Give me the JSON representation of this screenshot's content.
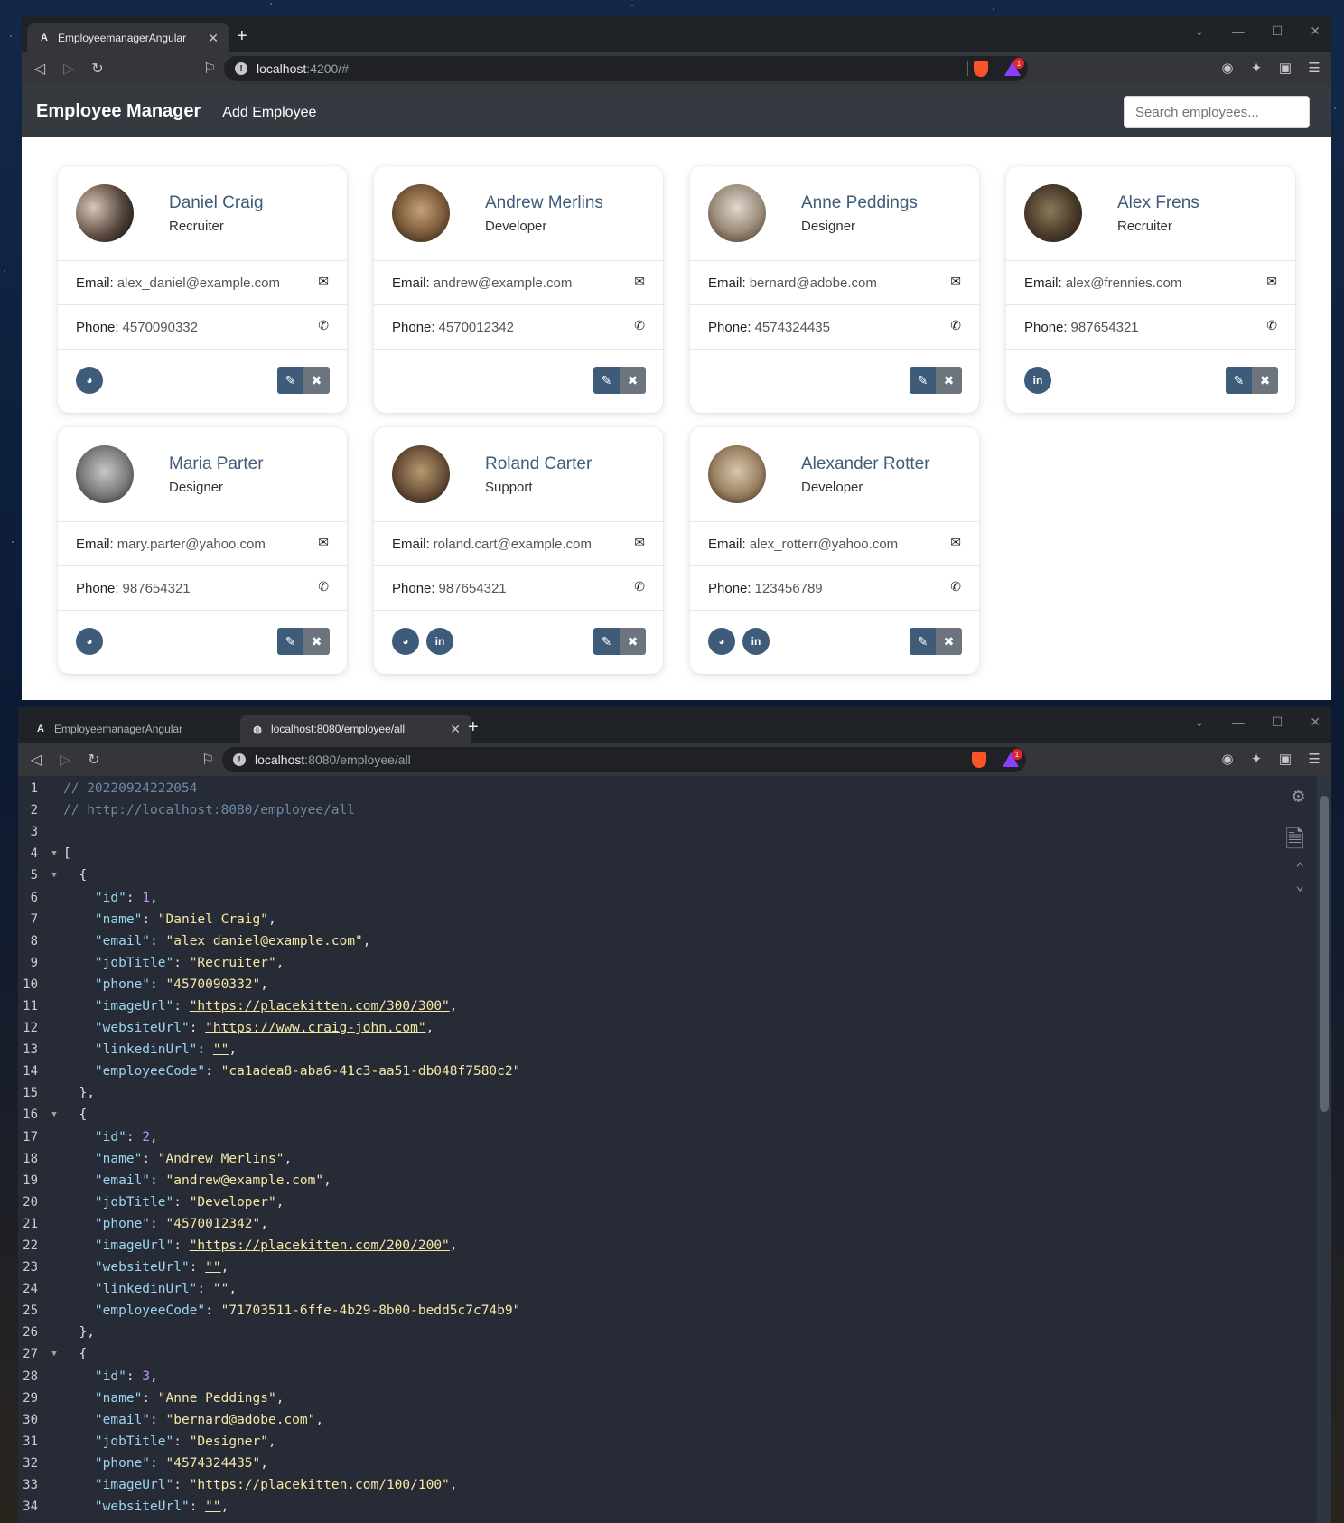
{
  "browser1": {
    "tabs": [
      {
        "title": "EmployeemanagerAngular"
      }
    ],
    "address_host": "localhost",
    "address_path": ":4200/#"
  },
  "app": {
    "brand": "Employee Manager",
    "add_link": "Add Employee",
    "search_placeholder": "Search employees..."
  },
  "labels": {
    "email": "Email:",
    "phone": "Phone:"
  },
  "employees": [
    {
      "name": "Daniel Craig",
      "job": "Recruiter",
      "email": "alex_daniel@example.com",
      "phone": "4570090332"
    },
    {
      "name": "Andrew Merlins",
      "job": "Developer",
      "email": "andrew@example.com",
      "phone": "4570012342"
    },
    {
      "name": "Anne Peddings",
      "job": "Designer",
      "email": "bernard@adobe.com",
      "phone": "4574324435"
    },
    {
      "name": "Alex Frens",
      "job": "Recruiter",
      "email": "alex@frennies.com",
      "phone": "987654321"
    },
    {
      "name": "Maria Parter",
      "job": "Designer",
      "email": "mary.parter@yahoo.com",
      "phone": "987654321"
    },
    {
      "name": "Roland Carter",
      "job": "Support",
      "email": "roland.cart@example.com",
      "phone": "987654321"
    },
    {
      "name": "Alexander Rotter",
      "job": "Developer",
      "email": "alex_rotterr@yahoo.com",
      "phone": "123456789"
    }
  ],
  "browser2": {
    "tabs": [
      {
        "title": "EmployeemanagerAngular"
      },
      {
        "title": "localhost:8080/employee/all"
      }
    ],
    "address_host": "localhost",
    "address_path": ":8080/employee/all"
  },
  "json_lines": [
    "// 20220924222054",
    "// http://localhost:8080/employee/all",
    "",
    "[",
    "  {",
    "    \"id\": 1,",
    "    \"name\": \"Daniel Craig\",",
    "    \"email\": \"alex_daniel@example.com\",",
    "    \"jobTitle\": \"Recruiter\",",
    "    \"phone\": \"4570090332\",",
    "    \"imageUrl\": \"https://placekitten.com/300/300\",",
    "    \"websiteUrl\": \"https://www.craig-john.com\",",
    "    \"linkedinUrl\": \"\",",
    "    \"employeeCode\": \"ca1adea8-aba6-41c3-aa51-db048f7580c2\"",
    "  },",
    "  {",
    "    \"id\": 2,",
    "    \"name\": \"Andrew Merlins\",",
    "    \"email\": \"andrew@example.com\",",
    "    \"jobTitle\": \"Developer\",",
    "    \"phone\": \"4570012342\",",
    "    \"imageUrl\": \"https://placekitten.com/200/200\",",
    "    \"websiteUrl\": \"\",",
    "    \"linkedinUrl\": \"\",",
    "    \"employeeCode\": \"71703511-6ffe-4b29-8b00-bedd5c7c74b9\"",
    "  },",
    "  {",
    "    \"id\": 3,",
    "    \"name\": \"Anne Peddings\",",
    "    \"email\": \"bernard@adobe.com\",",
    "    \"jobTitle\": \"Designer\",",
    "    \"phone\": \"4574324435\",",
    "    \"imageUrl\": \"https://placekitten.com/100/100\",",
    "    \"websiteUrl\": \"\","
  ]
}
